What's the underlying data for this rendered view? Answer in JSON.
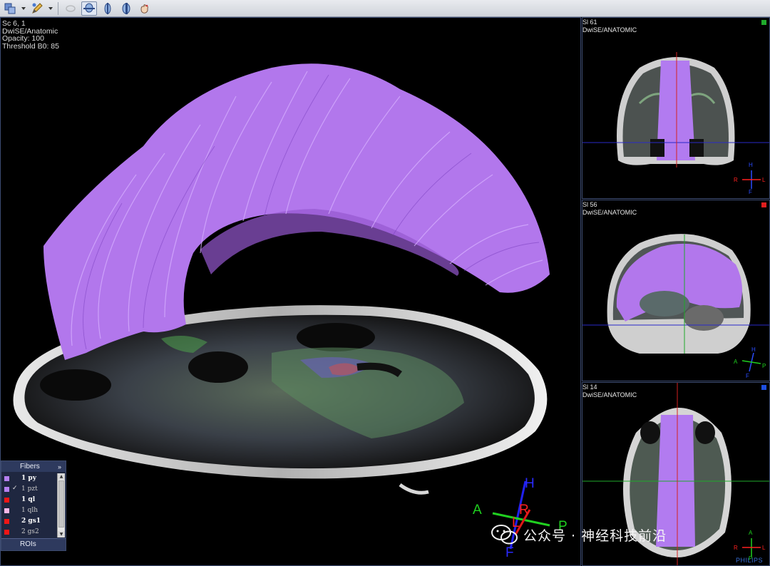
{
  "toolbar": {
    "items": [
      {
        "name": "layout-icon",
        "state": "normal"
      },
      {
        "name": "annotate-pencil-icon",
        "state": "normal"
      },
      {
        "name": "rotate-icon",
        "state": "disabled"
      },
      {
        "name": "axial-view-icon",
        "state": "active"
      },
      {
        "name": "coronal-view-icon",
        "state": "normal"
      },
      {
        "name": "sagittal-view-icon",
        "state": "normal"
      },
      {
        "name": "reset-hand-icon",
        "state": "normal"
      }
    ]
  },
  "main_view": {
    "overlay": {
      "series": "Sc 6, 1",
      "protocol": "DwiSE/Anatomic",
      "opacity": "Opacity: 100",
      "threshold": "Threshold B0: 85"
    },
    "orientation": {
      "head": "H",
      "anterior": "A",
      "right": "R",
      "left": "L",
      "posterior": "P",
      "foot": "F"
    },
    "fiber_color": "#b979f2"
  },
  "panels": [
    {
      "slice": "Sl 61",
      "protocol": "DwiSE/ANATOMIC",
      "marker_color": "#1faa2b",
      "orient": {
        "top": "H",
        "left": "R",
        "right": "L",
        "bottom": "F"
      }
    },
    {
      "slice": "Sl 56",
      "protocol": "DwiSE/ANATOMIC",
      "marker_color": "#e01e1e",
      "orient": {
        "top": "H",
        "left": "A",
        "right": "P",
        "bottom": "F"
      }
    },
    {
      "slice": "Sl 14",
      "protocol": "DwiSE/ANATOMIC",
      "marker_color": "#1e4fe0",
      "orient": {
        "top": "A",
        "left": "R",
        "right": "L",
        "bottom": "P"
      }
    }
  ],
  "fibers_panel": {
    "title": "Fibers",
    "expand_icon": "»",
    "items": [
      {
        "label": "1 py",
        "color": "#b57ff0",
        "checked": false,
        "dim": false
      },
      {
        "label": "1 pzt",
        "color": "#b57ff0",
        "checked": true,
        "dim": true
      },
      {
        "label": "1 ql",
        "color": "#f01616",
        "checked": false,
        "dim": false
      },
      {
        "label": "1 qlh",
        "color": "#f7b7e8",
        "checked": false,
        "dim": true
      },
      {
        "label": "2 gs1",
        "color": "#f01616",
        "checked": false,
        "dim": false
      },
      {
        "label": "2 gs2",
        "color": "#f01616",
        "checked": false,
        "dim": true
      }
    ],
    "rois_tab": "ROIs"
  },
  "watermark": {
    "text": "公众号 · 神经科技前沿"
  },
  "brand": "PHILIPS"
}
